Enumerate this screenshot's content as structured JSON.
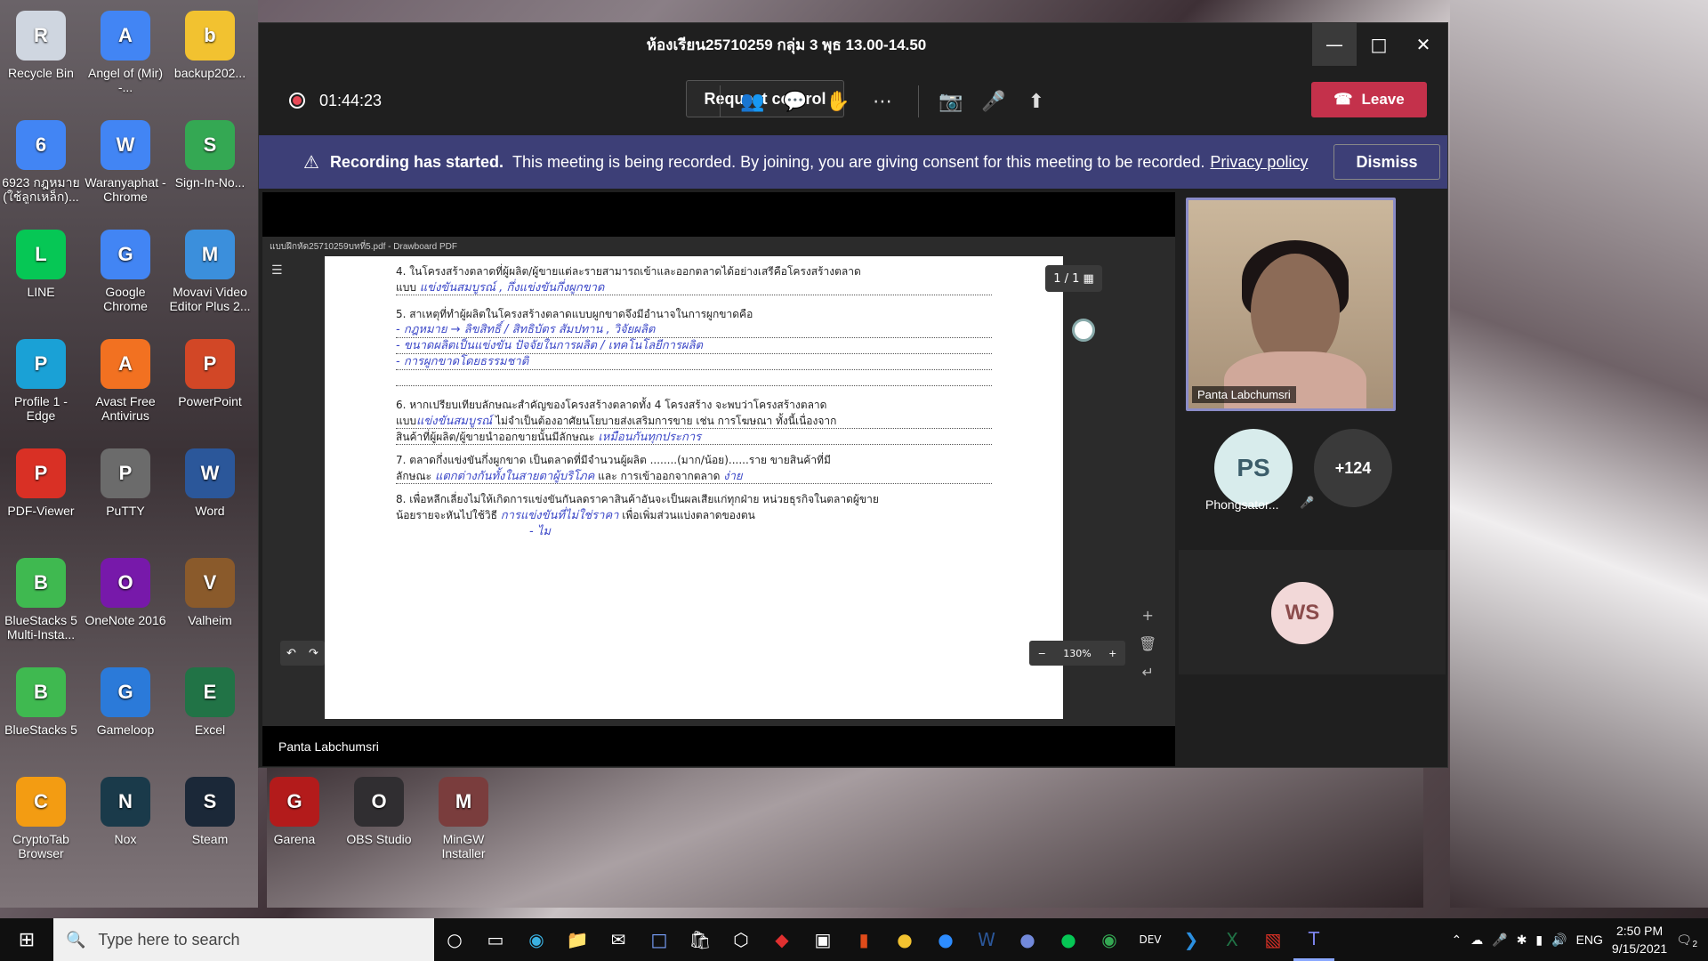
{
  "desktop": {
    "icons": [
      {
        "label": "Recycle Bin",
        "icon": "recycle-bin-icon",
        "color": "#cfd6e0"
      },
      {
        "label": "Angel of (Mir) -...",
        "icon": "chrome-icon",
        "color": "#4285f4"
      },
      {
        "label": "backup202...",
        "icon": "folder-icon",
        "color": "#f2c230"
      },
      {
        "label": "6923 กฎหมาย (ใช้ลูกเหล็ก)...",
        "icon": "chrome-icon",
        "color": "#4285f4"
      },
      {
        "label": "Waranyaphat - Chrome",
        "icon": "chrome-icon",
        "color": "#4285f4"
      },
      {
        "label": "Sign-In-No...",
        "icon": "sign-in-icon",
        "color": "#34a853"
      },
      {
        "label": "LINE",
        "icon": "line-icon",
        "color": "#06c755"
      },
      {
        "label": "Google Chrome",
        "icon": "chrome-icon",
        "color": "#4285f4"
      },
      {
        "label": "Movavi Video Editor Plus 2...",
        "icon": "movavi-icon",
        "color": "#3b8fdc"
      },
      {
        "label": "Profile 1 - Edge",
        "icon": "edge-icon",
        "color": "#1aa1d6"
      },
      {
        "label": "Avast Free Antivirus",
        "icon": "avast-icon",
        "color": "#f27121"
      },
      {
        "label": "PowerPoint",
        "icon": "powerpoint-icon",
        "color": "#d24726"
      },
      {
        "label": "PDF-Viewer",
        "icon": "pdf-icon",
        "color": "#d93025"
      },
      {
        "label": "PuTTY",
        "icon": "putty-icon",
        "color": "#6b6b6b"
      },
      {
        "label": "Word",
        "icon": "word-icon",
        "color": "#2b579a"
      },
      {
        "label": "BlueStacks 5 Multi-Insta...",
        "icon": "bluestacks-icon",
        "color": "#3fb950"
      },
      {
        "label": "OneNote 2016",
        "icon": "onenote-icon",
        "color": "#7719aa"
      },
      {
        "label": "Valheim",
        "icon": "valheim-icon",
        "color": "#8a5a2b"
      },
      {
        "label": "BlueStacks 5",
        "icon": "bluestacks-icon",
        "color": "#3fb950"
      },
      {
        "label": "Gameloop",
        "icon": "gameloop-icon",
        "color": "#2b7ad9"
      },
      {
        "label": "Excel",
        "icon": "excel-icon",
        "color": "#217346"
      },
      {
        "label": "CryptoTab Browser",
        "icon": "cryptotab-icon",
        "color": "#f39c12"
      },
      {
        "label": "Nox",
        "icon": "nox-icon",
        "color": "#1a3a4a"
      },
      {
        "label": "Steam",
        "icon": "steam-icon",
        "color": "#1b2838"
      },
      {
        "label": "Garena",
        "icon": "garena-icon",
        "color": "#b31b1b"
      },
      {
        "label": "OBS Studio",
        "icon": "obs-icon",
        "color": "#302e31"
      },
      {
        "label": "MinGW Installer",
        "icon": "mingw-icon",
        "color": "#7a3d3d"
      }
    ]
  },
  "teams": {
    "title": "ห้องเรียน25710259 กลุ่ม 3 พุธ 13.00-14.50",
    "timer": "01:44:23",
    "request_control": "Request control",
    "leave": "Leave",
    "banner": {
      "bold": "Recording has started.",
      "text": "This meeting is being recorded. By joining, you are giving consent for this meeting to be recorded.",
      "link": "Privacy policy",
      "dismiss": "Dismiss"
    },
    "pdf": {
      "window_title": "แบบฝึกหัด25710259บทที่5.pdf - Drawboard PDF",
      "page_indicator": "1 / 1",
      "zoom": "130%",
      "q4": "4. ในโครงสร้างตลาดที่ผู้ผลิต/ผู้ขายแต่ละรายสามารถเข้าและออกตลาดได้อย่างเสรีคือโครงสร้างตลาด",
      "q4_prefix": "แบบ",
      "q4_answer": "แข่งขันสมบูรณ์ , กึ่งแข่งขันกึ่งผูกขาด",
      "q5": "5. สาเหตุที่ทำผู้ผลิตในโครงสร้างตลาดแบบผูกขาดจึงมีอำนาจในการผูกขาดคือ",
      "q5_a1": "- กฎหมาย → ลิขสิทธิ์ / สิทธิบัตร สัมปทาน , วิจัยผลิต",
      "q5_a2": "- ขนาดผลิตเป็นแข่งขัน ปัจจัยในการผลิต / เทคโนโลยีการผลิต",
      "q5_a3": "- การผูกขาดโดยธรรมชาติ",
      "q6": "6. หากเปรียบเทียบลักษณะสำคัญของโครงสร้างตลาดทั้ง 4 โครงสร้าง จะพบว่าโครงสร้างตลาด",
      "q6_line2_prefix": "แบบ",
      "q6_answer1": "แข่งขันสมบูรณ์",
      "q6_line2_rest": "ไม่จำเป็นต้องอาศัยนโยบายส่งเสริมการขาย เช่น การโฆษณา ทั้งนี้เนื่องจาก",
      "q6_line3_prefix": "สินค้าที่ผู้ผลิต/ผู้ขายนำออกขายนั้นมีลักษณะ",
      "q6_answer2": "เหมือนกันทุกประการ",
      "q7": "7. ตลาดกึ่งแข่งขันกึ่งผูกขาด เป็นตลาดที่มีจำนวนผู้ผลิต ........(มาก/น้อย)......ราย ขายสินค้าที่มี",
      "q7_line2_prefix": "ลักษณะ",
      "q7_answer1": "แตกต่างกันทั้งในสายตาผู้บริโภค",
      "q7_line2_rest": "และ การเข้าออกจากตลาด",
      "q7_answer2": "ง่าย",
      "q8": "8. เพื่อหลีกเลี่ยงไม่ให้เกิดการแข่งขันกันลดราคาสินค้าอันจะเป็นผลเสียแก่ทุกฝ่าย หน่วยธุรกิจในตลาดผู้ขาย",
      "q8_line2_prefix": "น้อยรายจะหันไปใช้วิธี",
      "q8_answer": "การแข่งขันที่ไม่ใช่ราคา",
      "q8_line2_rest": "เพื่อเพิ่มส่วนแบ่งตลาดของตน",
      "q8_answer2": "- ไม"
    },
    "presenter_name": "Panta Labchumsri",
    "participants": {
      "video_name": "Panta Labchumsri",
      "ps_initials": "PS",
      "ps_name": "Phongsator...",
      "more": "+124",
      "ws_initials": "WS"
    }
  },
  "taskbar": {
    "search_placeholder": "Type here to search",
    "language": "ENG",
    "time": "2:50 PM",
    "date": "9/15/2021",
    "notifications": "2"
  }
}
